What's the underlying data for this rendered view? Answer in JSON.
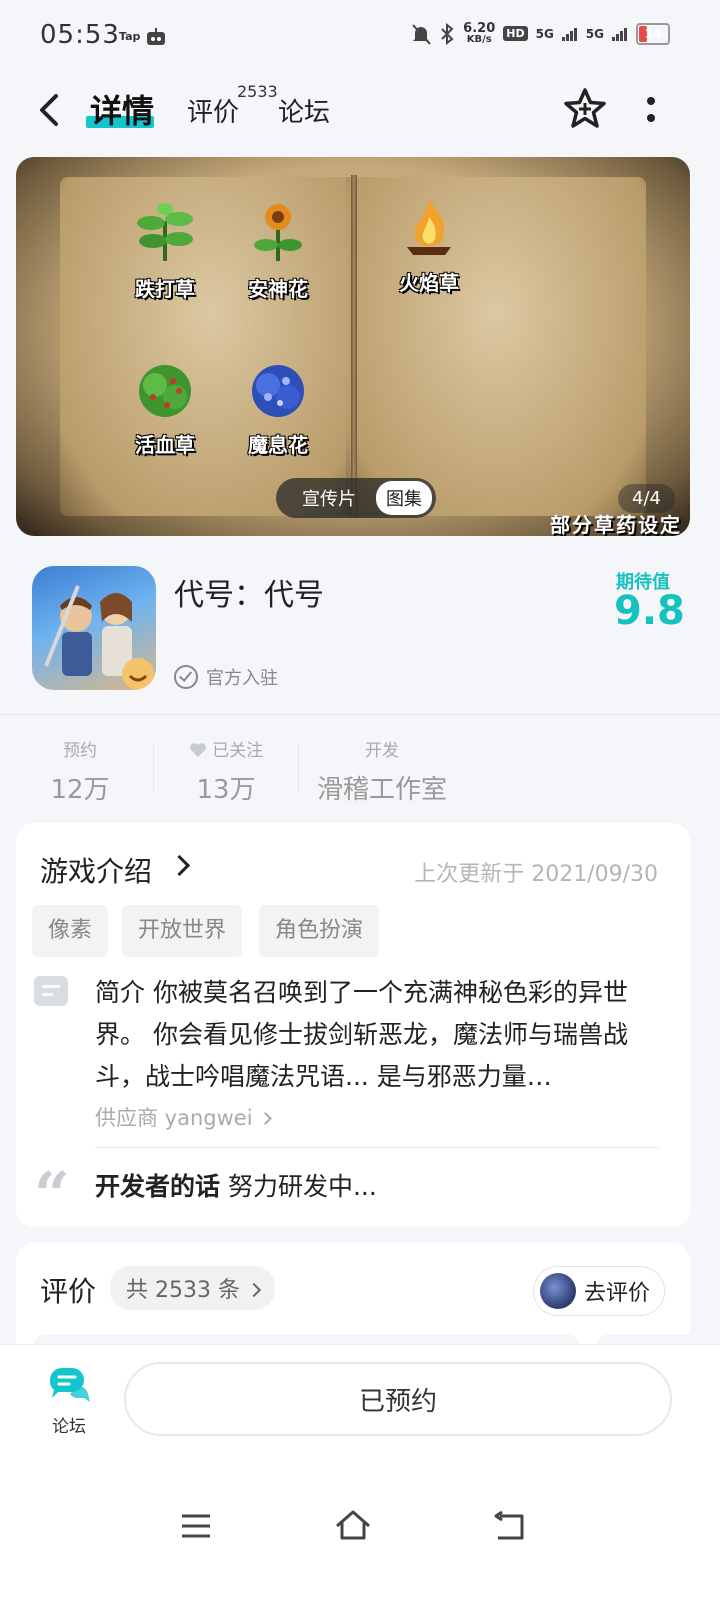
{
  "status_bar": {
    "time": "05:53",
    "tap_label": "Tap",
    "network_speed": "6.20",
    "network_unit": "KB/s",
    "hd_label": "HD",
    "signal1": "5G",
    "signal2": "5G",
    "battery": "14"
  },
  "header": {
    "tab_detail": "详情",
    "tab_review": "评价",
    "tab_review_count": "2533",
    "tab_forum": "论坛"
  },
  "banner": {
    "herbs": [
      "跌打草",
      "安神花",
      "火焰草",
      "活血草",
      "魔息花"
    ],
    "tab_video": "宣传片",
    "tab_gallery": "图集",
    "counter": "4/4",
    "caption": "部分草药设定"
  },
  "game": {
    "title": "代号：代号",
    "official": "官方入驻",
    "expect_label": "期待值",
    "expect_score": "9.8"
  },
  "stats": {
    "reserve_label": "预约",
    "reserve_value": "12万",
    "follow_label": "已关注",
    "follow_value": "13万",
    "dev_label": "开发",
    "dev_value": "滑稽工作室"
  },
  "intro": {
    "title": "游戏介绍",
    "updated": "上次更新于 2021/09/30",
    "tags": [
      "像素",
      "开放世界",
      "角色扮演"
    ],
    "description": "简介 你被莫名召唤到了一个充满神秘色彩的异世界。 你会看见修士拔剑斩恶龙，魔法师与瑞兽战斗，战士吟唱魔法咒语... 是与邪恶力量…",
    "supplier": "供应商 yangwei",
    "dev_words_label": "开发者的话",
    "dev_words": "努力研发中..."
  },
  "reviews": {
    "title": "评价",
    "count": "共 2533 条",
    "go_review": "去评价"
  },
  "bottom": {
    "forum_label": "论坛",
    "reserved_button": "已预约"
  },
  "colors": {
    "accent": "#15c5ce",
    "score": "#16c2c0"
  }
}
